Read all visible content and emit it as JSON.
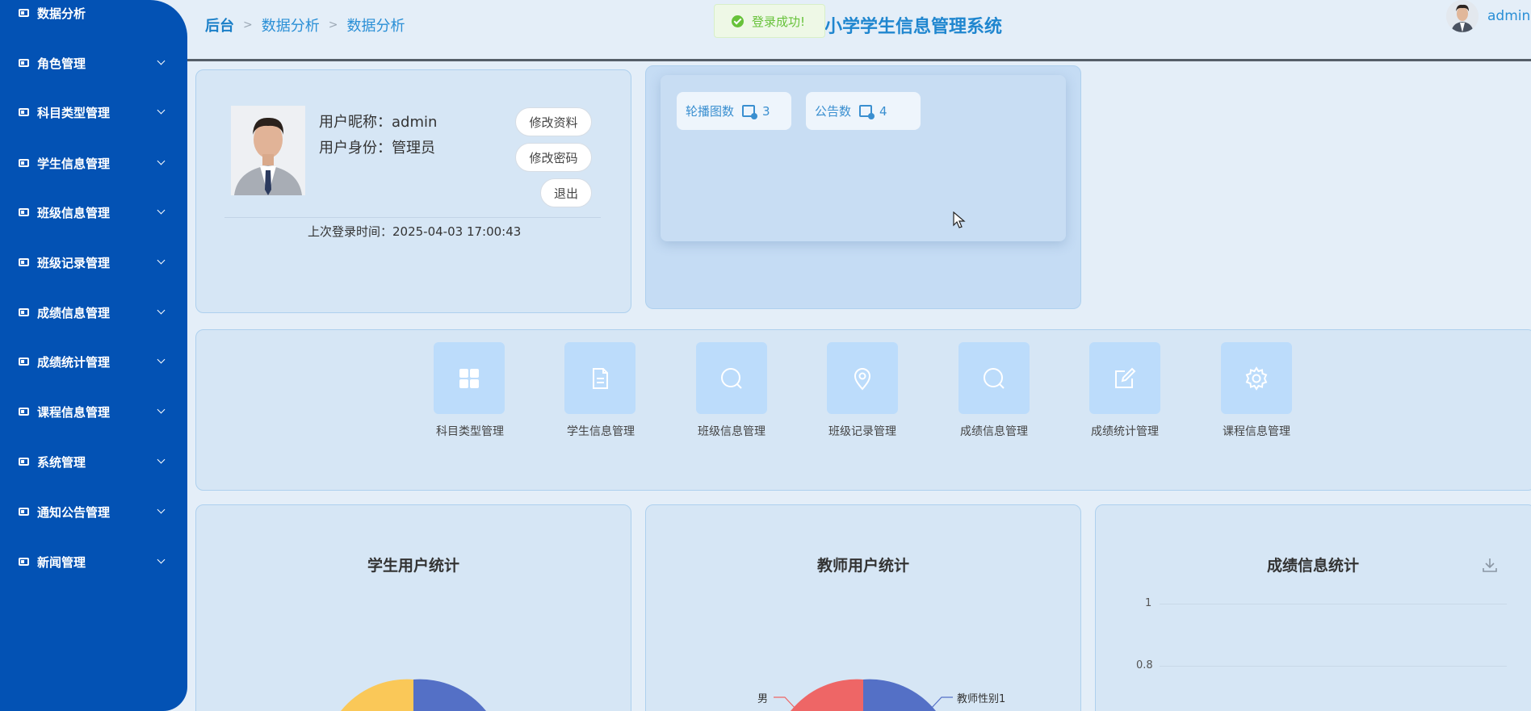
{
  "sidebar": {
    "items": [
      {
        "label": "数据分析"
      },
      {
        "label": "角色管理"
      },
      {
        "label": "科目类型管理"
      },
      {
        "label": "学生信息管理"
      },
      {
        "label": "班级信息管理"
      },
      {
        "label": "班级记录管理"
      },
      {
        "label": "成绩信息管理"
      },
      {
        "label": "成绩统计管理"
      },
      {
        "label": "课程信息管理"
      },
      {
        "label": "系统管理"
      },
      {
        "label": "通知公告管理"
      },
      {
        "label": "新闻管理"
      }
    ]
  },
  "header": {
    "breadcrumb": [
      "后台",
      "数据分析",
      "数据分析"
    ],
    "system_title": "小学学生信息管理系统",
    "toast": "登录成功!",
    "username": "admin"
  },
  "profile": {
    "nickname": "用户昵称：admin",
    "role": "用户身份：管理员",
    "edit_profile": "修改资料",
    "change_password": "修改密码",
    "logout": "退出",
    "last_login": "上次登录时间：2025-04-03 17:00:43"
  },
  "stats": [
    {
      "label": "轮播图数",
      "value": "3"
    },
    {
      "label": "公告数",
      "value": "4"
    }
  ],
  "quick_links": [
    {
      "label": "科目类型管理",
      "icon": "grid-icon"
    },
    {
      "label": "学生信息管理",
      "icon": "document-icon"
    },
    {
      "label": "班级信息管理",
      "icon": "search-icon"
    },
    {
      "label": "班级记录管理",
      "icon": "location-icon"
    },
    {
      "label": "成绩信息管理",
      "icon": "search-icon"
    },
    {
      "label": "成绩统计管理",
      "icon": "edit-icon"
    },
    {
      "label": "课程信息管理",
      "icon": "gear-icon"
    }
  ],
  "charts": {
    "student_title": "学生用户统计",
    "teacher_title": "教师用户统计",
    "score_title": "成绩信息统计",
    "teacher_legend_left": "男",
    "teacher_legend_right": "教师性别1",
    "score_ticks": [
      "1",
      "0.8"
    ]
  },
  "colors": {
    "sidebar": "#0352b4",
    "accent": "#1f86cf",
    "pie_blue": "#5470c6",
    "pie_yellow": "#fac858",
    "pie_red": "#ee6666"
  }
}
